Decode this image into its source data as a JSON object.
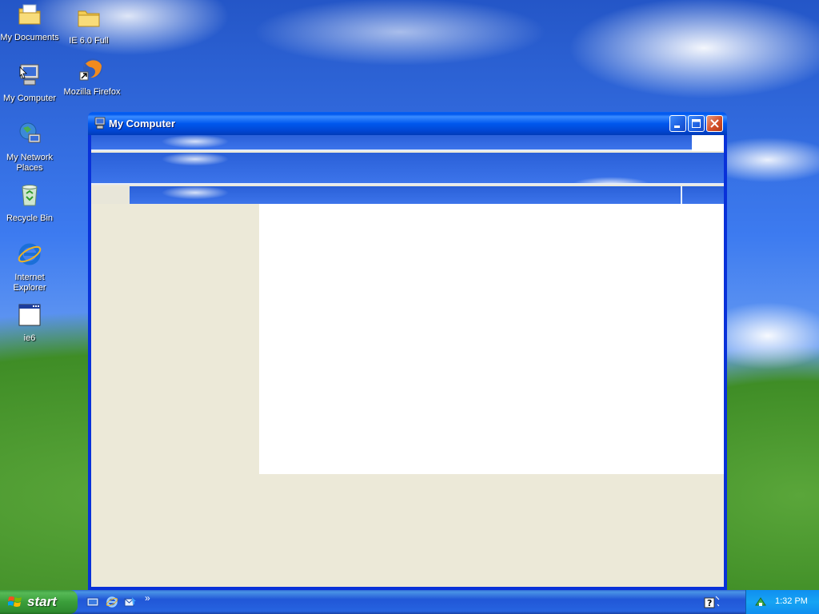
{
  "desktop": {
    "icons": [
      {
        "label": "My Documents",
        "icon": "my-documents-icon"
      },
      {
        "label": "IE 6.0 Full",
        "icon": "folder-icon"
      },
      {
        "label": "My Computer",
        "icon": "my-computer-icon"
      },
      {
        "label": "Mozilla Firefox",
        "icon": "firefox-icon"
      },
      {
        "label": "My Network Places",
        "icon": "network-places-icon"
      },
      {
        "label": "Recycle Bin",
        "icon": "recycle-bin-icon"
      },
      {
        "label": "Internet Explorer",
        "icon": "internet-explorer-icon"
      },
      {
        "label": "ie6",
        "icon": "window-app-icon"
      }
    ]
  },
  "window": {
    "title": "My Computer",
    "icon": "my-computer-icon"
  },
  "taskbar": {
    "start_label": "start",
    "clock": "1:32 PM",
    "chevron": "»",
    "quick_launch": [
      "show-desktop-icon",
      "internet-explorer-icon",
      "outlook-express-icon"
    ]
  },
  "colors": {
    "title_bar": "#0058ee",
    "window_frame": "#0831d9",
    "window_face": "#ece9d8",
    "taskbar": "#245edb",
    "start_button": "#3a9e3a",
    "tray": "#0f8ef0",
    "close_button": "#d4502a"
  }
}
